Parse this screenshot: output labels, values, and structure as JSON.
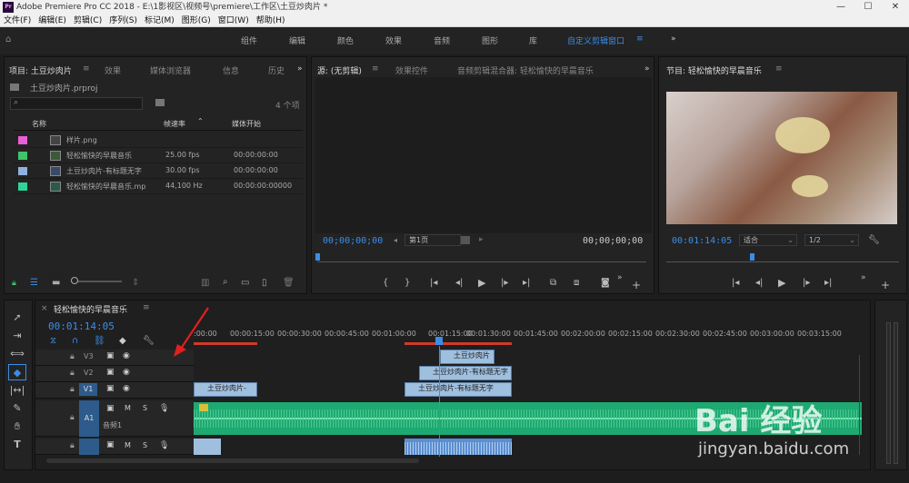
{
  "app": {
    "title": "Adobe Premiere Pro CC 2018 - E:\\1影视区\\视频号\\premiere\\工作区\\土豆炒肉片 *",
    "logo": "Pr"
  },
  "menu": [
    "文件(F)",
    "编辑(E)",
    "剪辑(C)",
    "序列(S)",
    "标记(M)",
    "图形(G)",
    "窗口(W)",
    "帮助(H)"
  ],
  "workspaces": [
    "组件",
    "编辑",
    "颜色",
    "效果",
    "音频",
    "图形",
    "库",
    "自定义剪辑窗口"
  ],
  "project": {
    "tabs": [
      "项目: 土豆炒肉片",
      "效果",
      "媒体浏览器",
      "信息",
      "历史"
    ],
    "file": "土豆炒肉片.prproj",
    "count": "4 个项",
    "columns": {
      "name": "名称",
      "fps": "帧速率",
      "start": "媒体开始"
    },
    "items": [
      {
        "name": "样片.png",
        "fps": "",
        "start": "",
        "color": "#e85fd6"
      },
      {
        "name": "轻松愉快的早晨音乐",
        "fps": "25.00 fps",
        "start": "00:00:00:00",
        "color": "#3fc46a"
      },
      {
        "name": "土豆炒肉片-有标题无字",
        "fps": "30.00 fps",
        "start": "00:00:00:00",
        "color": "#8fb2e0"
      },
      {
        "name": "轻松愉快的早晨音乐.mp",
        "fps": "44,100 Hz",
        "start": "00:00:00:00000",
        "color": "#2fd39a"
      }
    ]
  },
  "source": {
    "tabs": [
      "源: (无剪辑)",
      "效果控件",
      "音频剪辑混合器: 轻松愉快的早晨音乐"
    ],
    "tc_left": "00;00;00;00",
    "page": "第1页",
    "tc_right": "00;00;00;00"
  },
  "program": {
    "tab": "节目: 轻松愉快的早晨音乐",
    "tc": "00:01:14:05",
    "fit": "适合",
    "quality": "1/2"
  },
  "timeline": {
    "seq": "轻松愉快的早晨音乐",
    "tc": "00:01:14:05",
    "ruler": [
      ":00:00",
      "00:00:15:00",
      "00:00:30:00",
      "00:00:45:00",
      "00:01:00:00",
      "00:01:15:00",
      "00:01:30:00",
      "00:01:45:00",
      "00:02:00:00",
      "00:02:15:00",
      "00:02:30:00",
      "00:02:45:00",
      "00:03:00:00",
      "00:03:15:00"
    ],
    "tracks": {
      "v3": "V3",
      "v2": "V2",
      "v1": "V1",
      "a1": "A1",
      "a1name": "音频1"
    },
    "clips": {
      "c1": "土豆炒肉片",
      "c2": "土豆炒肉片-有标题无字",
      "c3": "土豆炒肉片-",
      "c4": "土豆炒肉片-有标题无字"
    }
  },
  "watermark": {
    "brand": "Bai 经验",
    "url": "jingyan.baidu.com"
  }
}
